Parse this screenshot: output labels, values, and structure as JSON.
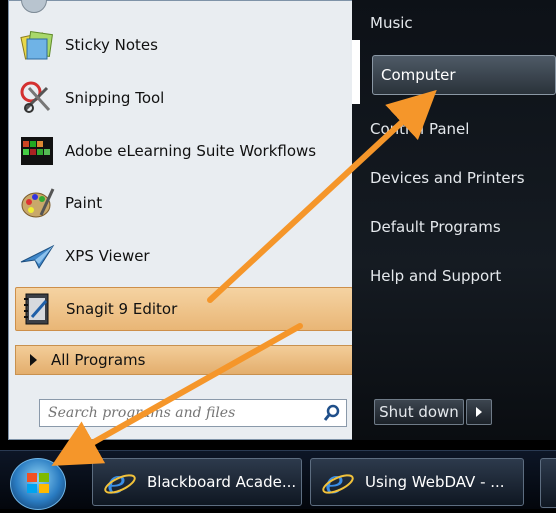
{
  "pinned_items": [
    {
      "label": "Sticky Notes",
      "icon": "sticky-notes-icon"
    },
    {
      "label": "Snipping Tool",
      "icon": "scissors-icon"
    },
    {
      "label": "Adobe eLearning Suite Workflows",
      "icon": "adobe-elearning-icon"
    },
    {
      "label": "Paint",
      "icon": "paint-palette-icon"
    },
    {
      "label": "XPS Viewer",
      "icon": "xps-viewer-icon"
    },
    {
      "label": "Snagit 9 Editor",
      "icon": "snagit-icon"
    }
  ],
  "all_programs": "All Programs",
  "search": {
    "placeholder": "Search programs and files",
    "icon": "search-icon"
  },
  "right_items": [
    "Music",
    "Computer",
    "Control Panel",
    "Devices and Printers",
    "Default Programs",
    "Help and Support"
  ],
  "shutdown": "Shut down",
  "taskbar": [
    {
      "label": "Blackboard Acade...",
      "icon": "internet-explorer-icon"
    },
    {
      "label": "Using WebDAV - ...",
      "icon": "internet-explorer-icon"
    }
  ],
  "colors": {
    "highlight": "#e9b676",
    "annotation_arrow": "#f5962a"
  }
}
